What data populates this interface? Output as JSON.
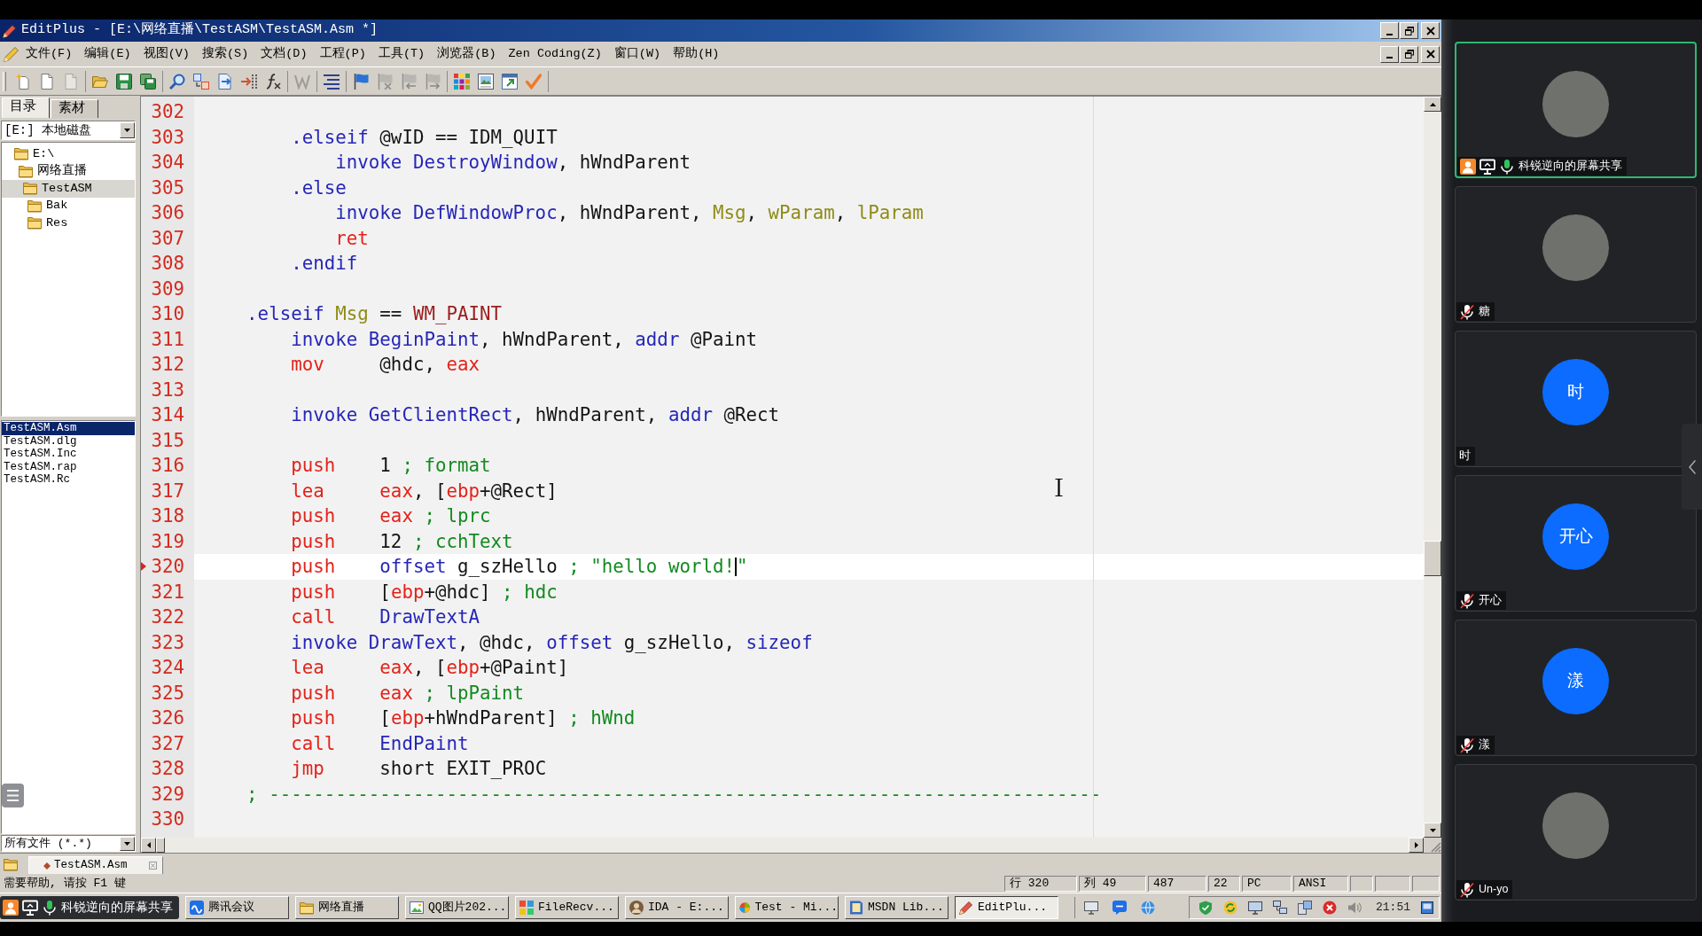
{
  "window": {
    "title": "EditPlus - [E:\\网络直播\\TestASM\\TestASM.Asm *]"
  },
  "menu": [
    "文件(F)",
    "编辑(E)",
    "视图(V)",
    "搜索(S)",
    "文档(D)",
    "工程(P)",
    "工具(T)",
    "浏览器(B)",
    "Zen Coding(Z)",
    "窗口(W)",
    "帮助(H)"
  ],
  "toolbar": {
    "groups": [
      {
        "buttons": [
          {
            "kind": "new",
            "disabled": false
          },
          {
            "kind": "document",
            "disabled": false
          },
          {
            "kind": "document",
            "disabled": true
          }
        ]
      },
      {
        "buttons": [
          {
            "kind": "open",
            "disabled": false
          },
          {
            "kind": "save",
            "disabled": false
          },
          {
            "kind": "saveall",
            "disabled": false
          }
        ]
      },
      {
        "buttons": [
          {
            "kind": "find",
            "disabled": false
          },
          {
            "kind": "replace",
            "disabled": false
          },
          {
            "kind": "goto",
            "disabled": false
          },
          {
            "kind": "indent",
            "disabled": false
          },
          {
            "kind": "function",
            "disabled": false
          }
        ]
      },
      {
        "buttons": [
          {
            "kind": "wrap",
            "disabled": true
          }
        ]
      },
      {
        "buttons": [
          {
            "kind": "lines",
            "disabled": false
          }
        ]
      },
      {
        "buttons": [
          {
            "kind": "flag",
            "disabled": false
          },
          {
            "kind": "flagclear",
            "disabled": true
          },
          {
            "kind": "flagprev",
            "disabled": true
          },
          {
            "kind": "flagnext",
            "disabled": true
          }
        ]
      },
      {
        "buttons": [
          {
            "kind": "colors",
            "disabled": false
          },
          {
            "kind": "preview",
            "disabled": false
          },
          {
            "kind": "browser",
            "disabled": false
          },
          {
            "kind": "check",
            "disabled": false
          }
        ]
      }
    ]
  },
  "sidebar": {
    "tabs": [
      {
        "label": "目录",
        "selected": true
      },
      {
        "label": "素材",
        "selected": false
      }
    ],
    "drive": "[E:] 本地磁盘",
    "tree": [
      {
        "label": "E:\\",
        "selected": false,
        "children": [
          {
            "label": "网络直播",
            "selected": false,
            "children": [
              {
                "label": "TestASM",
                "selected": true,
                "children": [
                  {
                    "label": "Bak",
                    "selected": false
                  },
                  {
                    "label": "Res",
                    "selected": false
                  }
                ]
              }
            ]
          }
        ]
      }
    ],
    "files": [
      {
        "label": "TestASM.Asm",
        "selected": true
      },
      {
        "label": "TestASM.dlg",
        "selected": false
      },
      {
        "label": "TestASM.Inc",
        "selected": false
      },
      {
        "label": "TestASM.rap",
        "selected": false
      },
      {
        "label": "TestASM.Rc",
        "selected": false
      }
    ],
    "filter": "所有文件 (*.*)"
  },
  "editor": {
    "lines": [
      {
        "number": "302",
        "current": false
      },
      {
        "number": "303",
        "current": false,
        "tokens": [
          {
            "kind": "keyword",
            "text": "        .elseif"
          },
          {
            "kind": "plain",
            "text": " @wID == IDM_QUIT"
          }
        ]
      },
      {
        "number": "304",
        "current": false,
        "tokens": [
          {
            "kind": "keyword",
            "text": "            invoke DestroyWindow"
          },
          {
            "kind": "plain",
            "text": ", hWndParent"
          }
        ]
      },
      {
        "number": "305",
        "current": false,
        "tokens": [
          {
            "kind": "keyword",
            "text": "        .else"
          }
        ]
      },
      {
        "number": "306",
        "current": false,
        "tokens": [
          {
            "kind": "keyword",
            "text": "            invoke DefWindowProc"
          },
          {
            "kind": "plain",
            "text": ", hWndParent, "
          },
          {
            "kind": "argument",
            "text": "Msg"
          },
          {
            "kind": "plain",
            "text": ", "
          },
          {
            "kind": "argument",
            "text": "wParam"
          },
          {
            "kind": "plain",
            "text": ", "
          },
          {
            "kind": "argument",
            "text": "lParam"
          }
        ]
      },
      {
        "number": "307",
        "current": false,
        "tokens": [
          {
            "kind": "reserved",
            "text": "            ret"
          }
        ]
      },
      {
        "number": "308",
        "current": false,
        "tokens": [
          {
            "kind": "keyword",
            "text": "        .endif"
          }
        ]
      },
      {
        "number": "309",
        "current": false
      },
      {
        "number": "310",
        "current": false,
        "tokens": [
          {
            "kind": "keyword",
            "text": "    .elseif "
          },
          {
            "kind": "argument",
            "text": "Msg"
          },
          {
            "kind": "plain",
            "text": " == "
          },
          {
            "kind": "constant",
            "text": "WM_PAINT"
          }
        ]
      },
      {
        "number": "311",
        "current": false,
        "tokens": [
          {
            "kind": "keyword",
            "text": "        invoke BeginPaint"
          },
          {
            "kind": "plain",
            "text": ", hWndParent, "
          },
          {
            "kind": "keyword",
            "text": "addr"
          },
          {
            "kind": "plain",
            "text": " @Paint"
          }
        ]
      },
      {
        "number": "312",
        "current": false,
        "tokens": [
          {
            "kind": "reserved",
            "text": "        mov"
          },
          {
            "kind": "plain",
            "text": "     @hdc, "
          },
          {
            "kind": "reserved",
            "text": "eax"
          }
        ]
      },
      {
        "number": "313",
        "current": false
      },
      {
        "number": "314",
        "current": false,
        "tokens": [
          {
            "kind": "keyword",
            "text": "        invoke GetClientRect"
          },
          {
            "kind": "plain",
            "text": ", hWndParent, "
          },
          {
            "kind": "keyword",
            "text": "addr"
          },
          {
            "kind": "plain",
            "text": " @Rect"
          }
        ]
      },
      {
        "number": "315",
        "current": false
      },
      {
        "number": "316",
        "current": false,
        "tokens": [
          {
            "kind": "reserved",
            "text": "        push"
          },
          {
            "kind": "plain",
            "text": "    1 "
          },
          {
            "kind": "comment",
            "text": "; format"
          }
        ]
      },
      {
        "number": "317",
        "current": false,
        "tokens": [
          {
            "kind": "reserved",
            "text": "        lea     eax"
          },
          {
            "kind": "plain",
            "text": ", ["
          },
          {
            "kind": "reserved",
            "text": "ebp"
          },
          {
            "kind": "plain",
            "text": "+@Rect]"
          }
        ]
      },
      {
        "number": "318",
        "current": false,
        "tokens": [
          {
            "kind": "reserved",
            "text": "        push    eax"
          },
          {
            "kind": "comment",
            "text": " ; lprc"
          }
        ]
      },
      {
        "number": "319",
        "current": false,
        "tokens": [
          {
            "kind": "reserved",
            "text": "        push"
          },
          {
            "kind": "plain",
            "text": "    12 "
          },
          {
            "kind": "comment",
            "text": "; cchText"
          }
        ]
      },
      {
        "number": "320",
        "current": true,
        "tokens": [
          {
            "kind": "reserved",
            "text": "        push    "
          },
          {
            "kind": "keyword",
            "text": "offset"
          },
          {
            "kind": "plain",
            "text": " g_szHello "
          },
          {
            "kind": "comment",
            "text": "; \"hello world!"
          },
          {
            "kind": "cursor"
          },
          {
            "kind": "comment",
            "text": "\""
          }
        ]
      },
      {
        "number": "321",
        "current": false,
        "tokens": [
          {
            "kind": "reserved",
            "text": "        push"
          },
          {
            "kind": "plain",
            "text": "    ["
          },
          {
            "kind": "reserved",
            "text": "ebp"
          },
          {
            "kind": "plain",
            "text": "+@hdc] "
          },
          {
            "kind": "comment",
            "text": "; hdc"
          }
        ]
      },
      {
        "number": "322",
        "current": false,
        "tokens": [
          {
            "kind": "reserved",
            "text": "        call    "
          },
          {
            "kind": "keyword",
            "text": "DrawTextA"
          }
        ]
      },
      {
        "number": "323",
        "current": false,
        "tokens": [
          {
            "kind": "keyword",
            "text": "        invoke DrawText"
          },
          {
            "kind": "plain",
            "text": ", @hdc, "
          },
          {
            "kind": "keyword",
            "text": "offset"
          },
          {
            "kind": "plain",
            "text": " g_szHello, "
          },
          {
            "kind": "keyword",
            "text": "sizeof"
          }
        ]
      },
      {
        "number": "324",
        "current": false,
        "tokens": [
          {
            "kind": "reserved",
            "text": "        lea     eax"
          },
          {
            "kind": "plain",
            "text": ", ["
          },
          {
            "kind": "reserved",
            "text": "ebp"
          },
          {
            "kind": "plain",
            "text": "+@Paint]"
          }
        ]
      },
      {
        "number": "325",
        "current": false,
        "tokens": [
          {
            "kind": "reserved",
            "text": "        push    eax"
          },
          {
            "kind": "comment",
            "text": " ; lpPaint"
          }
        ]
      },
      {
        "number": "326",
        "current": false,
        "tokens": [
          {
            "kind": "reserved",
            "text": "        push"
          },
          {
            "kind": "plain",
            "text": "    ["
          },
          {
            "kind": "reserved",
            "text": "ebp"
          },
          {
            "kind": "plain",
            "text": "+hWndParent] "
          },
          {
            "kind": "comment",
            "text": "; hWnd"
          }
        ]
      },
      {
        "number": "327",
        "current": false,
        "tokens": [
          {
            "kind": "reserved",
            "text": "        call    "
          },
          {
            "kind": "keyword",
            "text": "EndPaint"
          }
        ]
      },
      {
        "number": "328",
        "current": false,
        "tokens": [
          {
            "kind": "reserved",
            "text": "        jmp"
          },
          {
            "kind": "plain",
            "text": "     short EXIT_PROC"
          }
        ]
      },
      {
        "number": "329",
        "current": false,
        "tokens": [
          {
            "kind": "comment",
            "text": "    ; ---------------------------------------------------------------------------"
          }
        ]
      },
      {
        "number": "330",
        "current": false
      }
    ]
  },
  "document_tabs": [
    {
      "label": "TestASM.Asm",
      "selected": true
    }
  ],
  "status_bar": {
    "message": "需要帮助, 请按 F1 键",
    "panels": [
      "行 320",
      "列 49",
      "487",
      "22",
      "PC",
      "ANSI"
    ]
  },
  "taskbar": {
    "sharing": "科锐逆向的屏幕共享",
    "buttons": [
      {
        "label": "腾讯会议",
        "kind": "meeting",
        "selected": false
      },
      {
        "label": "网络直播",
        "kind": "folder",
        "selected": false
      },
      {
        "label": "QQ图片202...",
        "kind": "image",
        "selected": false
      },
      {
        "label": "FileRecv...",
        "kind": "grid",
        "selected": false
      },
      {
        "label": "IDA - E:...",
        "kind": "person",
        "selected": false
      },
      {
        "label": "Test - Mi...",
        "kind": "ball",
        "selected": false
      },
      {
        "label": "MSDN Lib...",
        "kind": "book",
        "selected": false
      },
      {
        "label": "EditPlu...",
        "kind": "editor",
        "selected": true
      }
    ],
    "clock": "21:51"
  },
  "meeting": {
    "participants": [
      {
        "name": "科锐逆向的屏幕共享",
        "avatar": {
          "kind": "photo"
        },
        "host": true,
        "sharing": true,
        "mic": {
          "muted": false
        },
        "speaking": true
      },
      {
        "name": "糖",
        "avatar": {
          "kind": "photo"
        },
        "host": false,
        "sharing": false,
        "mic": {
          "muted": true
        },
        "speaking": false
      },
      {
        "name": "时",
        "avatar": {
          "kind": "initials",
          "text": "时"
        },
        "host": false,
        "sharing": false,
        "speaking": false
      },
      {
        "name": "开心",
        "avatar": {
          "kind": "initials",
          "text": "开心"
        },
        "host": false,
        "sharing": false,
        "mic": {
          "muted": true
        },
        "speaking": false
      },
      {
        "name": "漾",
        "avatar": {
          "kind": "initials",
          "text": "漾"
        },
        "host": false,
        "sharing": false,
        "mic": {
          "muted": true
        },
        "speaking": false
      },
      {
        "name": "Un-yo",
        "avatar": {
          "kind": "photo"
        },
        "host": false,
        "sharing": false,
        "mic": {
          "muted": true
        },
        "speaking": false
      }
    ]
  }
}
